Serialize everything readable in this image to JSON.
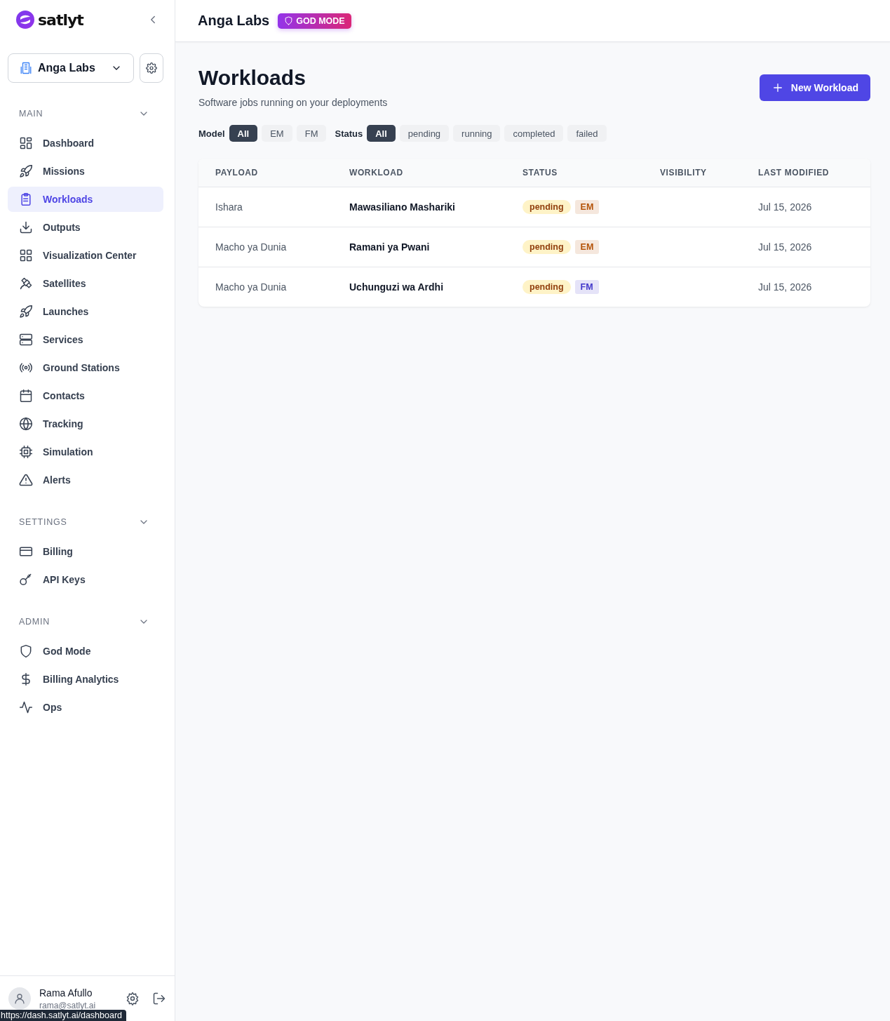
{
  "brand": {
    "name": "satlyt"
  },
  "org_switcher": {
    "label": "Anga Labs"
  },
  "nav_sections": [
    {
      "title": "MAIN",
      "expanded": true,
      "items": [
        {
          "label": "Dashboard",
          "selected": false
        },
        {
          "label": "Missions",
          "selected": false
        },
        {
          "label": "Workloads",
          "selected": true
        },
        {
          "label": "Outputs",
          "selected": false
        },
        {
          "label": "Visualization Center",
          "selected": false
        },
        {
          "label": "Satellites",
          "selected": false
        },
        {
          "label": "Launches",
          "selected": false
        },
        {
          "label": "Services",
          "selected": false
        },
        {
          "label": "Ground Stations",
          "selected": false
        },
        {
          "label": "Contacts",
          "selected": false
        },
        {
          "label": "Tracking",
          "selected": false
        },
        {
          "label": "Simulation",
          "selected": false
        },
        {
          "label": "Alerts",
          "selected": false
        }
      ]
    },
    {
      "title": "SETTINGS",
      "expanded": true,
      "items": [
        {
          "label": "Billing",
          "selected": false
        },
        {
          "label": "API Keys",
          "selected": false
        }
      ]
    },
    {
      "title": "ADMIN",
      "expanded": true,
      "items": [
        {
          "label": "God Mode",
          "selected": false
        },
        {
          "label": "Billing Analytics",
          "selected": false
        },
        {
          "label": "Ops",
          "selected": false
        }
      ]
    }
  ],
  "user": {
    "name": "Rama Afullo",
    "email": "rama@satlyt.ai"
  },
  "link_preview": "https://dash.satlyt.ai/dashboard",
  "header": {
    "title": "Anga Labs",
    "badge": "GOD MODE"
  },
  "page": {
    "title": "Workloads",
    "subtitle": "Software jobs running on your deployments",
    "new_button": "New Workload"
  },
  "filters": [
    {
      "label": "Model",
      "options": [
        {
          "label": "All",
          "selected": true
        },
        {
          "label": "EM",
          "selected": false
        },
        {
          "label": "FM",
          "selected": false
        }
      ]
    },
    {
      "label": "Status",
      "options": [
        {
          "label": "All",
          "selected": true
        },
        {
          "label": "pending",
          "selected": false
        },
        {
          "label": "running",
          "selected": false
        },
        {
          "label": "completed",
          "selected": false
        },
        {
          "label": "failed",
          "selected": false
        }
      ]
    }
  ],
  "table": {
    "columns": [
      "PAYLOAD",
      "WORKLOAD",
      "STATUS",
      "VISIBILITY",
      "LAST MODIFIED"
    ],
    "rows": [
      {
        "payload": "Ishara",
        "workload": "Mawasiliano Mashariki",
        "status": "pending",
        "model": {
          "label": "EM",
          "color": "#b45309"
        },
        "last_modified": "Jul 15, 2026"
      },
      {
        "payload": "Macho ya Dunia",
        "workload": "Ramani ya Pwani",
        "status": "pending",
        "model": {
          "label": "EM",
          "color": "#b45309"
        },
        "last_modified": "Jul 15, 2026"
      },
      {
        "payload": "Macho ya Dunia",
        "workload": "Uchunguzi wa Ardhi",
        "status": "pending",
        "model": {
          "label": "FM",
          "color": "#4338ca"
        },
        "last_modified": "Jul 15, 2026"
      }
    ]
  }
}
